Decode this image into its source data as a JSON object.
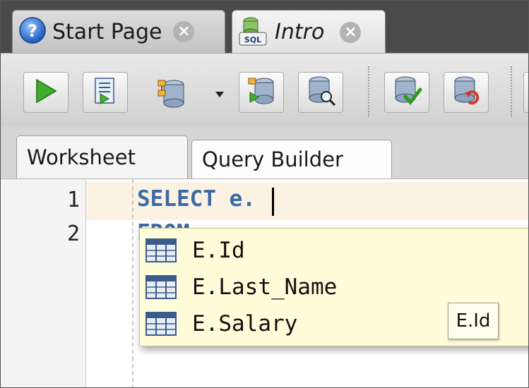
{
  "doc_tabs": [
    {
      "label": "Start Page",
      "icon": "help-icon"
    },
    {
      "label": "Intro",
      "icon": "sql-file-icon"
    }
  ],
  "toolbar": {
    "buttons": [
      "run-statement",
      "run-script",
      "autotrace",
      "dropdown",
      "explain-plan",
      "sql-tuning",
      "commit",
      "rollback"
    ]
  },
  "sub_tabs": [
    {
      "label": "Worksheet"
    },
    {
      "label": "Query Builder"
    }
  ],
  "editor": {
    "lines": [
      {
        "num": "1",
        "text": "SELECT e."
      },
      {
        "num": "2",
        "text": "FROM"
      }
    ]
  },
  "completion": {
    "items": [
      "E.Id",
      "E.Last_Name",
      "E.Salary"
    ],
    "tooltip": "E.Id"
  },
  "colors": {
    "keyword": "#3c6aa5",
    "popup_bg": "#fefcd9",
    "current_line": "#fbf2e4"
  }
}
